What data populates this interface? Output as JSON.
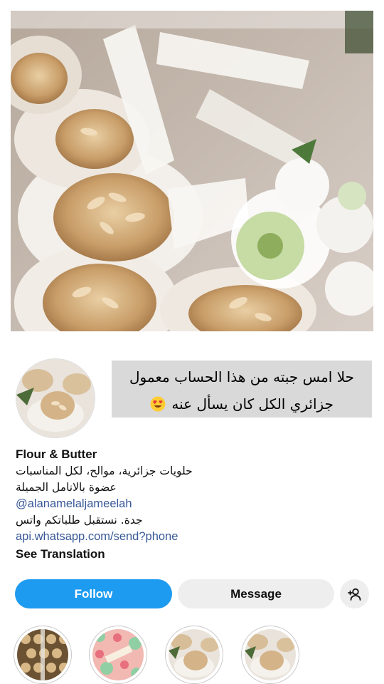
{
  "post": {
    "caption_line1": "حلا امس جبته من هذا الحساب معمول",
    "caption_line2": "جزائري الكل كان يسأل عنه"
  },
  "profile": {
    "name": "Flour & Butter",
    "bio_line1": "حلويات جزائرية، موالح، لكل المناسبات",
    "bio_line2": "عضوة بالانامل الجميلة",
    "mention": "@alanamelaljameelah",
    "bio_line3": "جدة. نستقبل طلباتكم واتس",
    "link": "api.whatsapp.com/send?phone",
    "see_translation": "See Translation"
  },
  "actions": {
    "follow_label": "Follow",
    "message_label": "Message"
  },
  "icons": {
    "add_user": "person-add-icon",
    "emoji": "heart-eyes-emoji"
  },
  "colors": {
    "follow_bg": "#1d9bf0",
    "link": "#385898",
    "caption_bg": "#d9d9d9",
    "secondary_btn": "#eeeeef"
  }
}
